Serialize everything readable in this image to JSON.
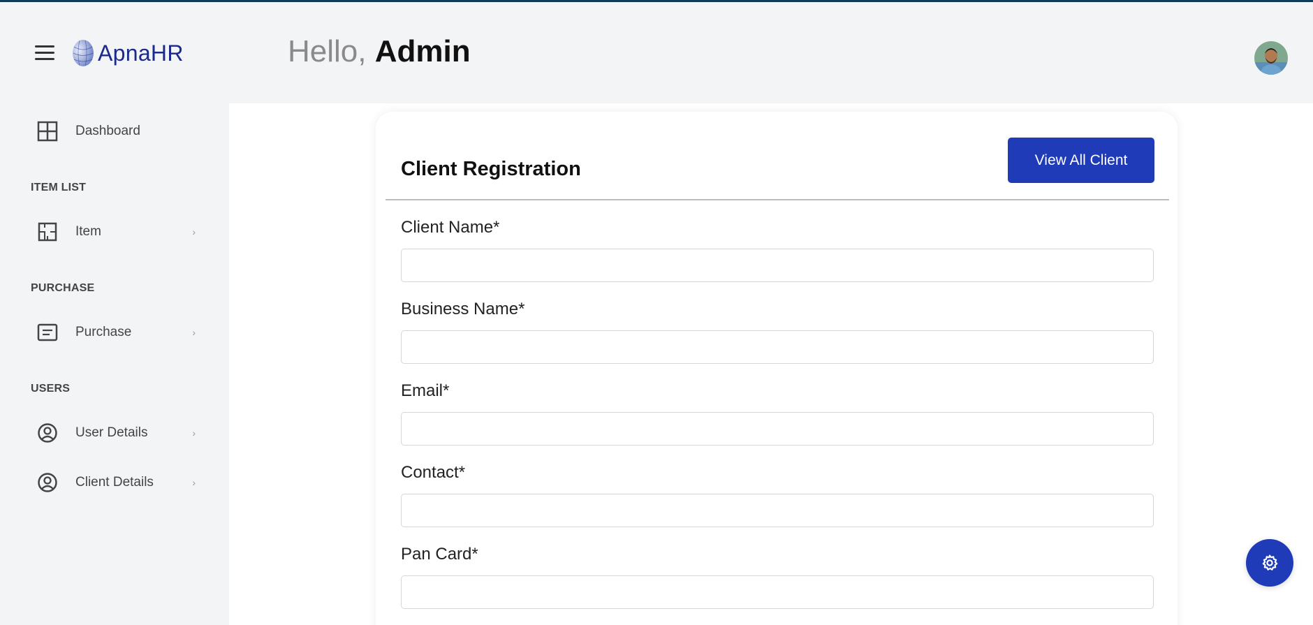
{
  "brand": {
    "name": "ApnaHR",
    "color": "#1b2a8c"
  },
  "header": {
    "greeting": "Hello,",
    "user_name": "Admin"
  },
  "sidebar": {
    "dashboard": {
      "label": "Dashboard",
      "icon": "grid-icon"
    },
    "sections": [
      {
        "title": "ITEM LIST",
        "items": [
          {
            "label": "Item",
            "icon": "floorplan-icon"
          }
        ]
      },
      {
        "title": "PURCHASE",
        "items": [
          {
            "label": "Purchase",
            "icon": "document-icon"
          }
        ]
      },
      {
        "title": "USERS",
        "items": [
          {
            "label": "User Details",
            "icon": "user-circle-icon"
          },
          {
            "label": "Client Details",
            "icon": "user-circle-icon"
          }
        ]
      }
    ],
    "chevron": "›"
  },
  "form": {
    "title": "Client Registration",
    "view_button": "View All Client",
    "fields": [
      {
        "label": "Client Name*",
        "value": ""
      },
      {
        "label": "Business Name*",
        "value": ""
      },
      {
        "label": "Email*",
        "value": ""
      },
      {
        "label": "Contact*",
        "value": ""
      },
      {
        "label": "Pan Card*",
        "value": ""
      }
    ]
  },
  "colors": {
    "accent": "#1f3bb8",
    "topline": "#0f3b57",
    "background": "#f3f4f6"
  }
}
